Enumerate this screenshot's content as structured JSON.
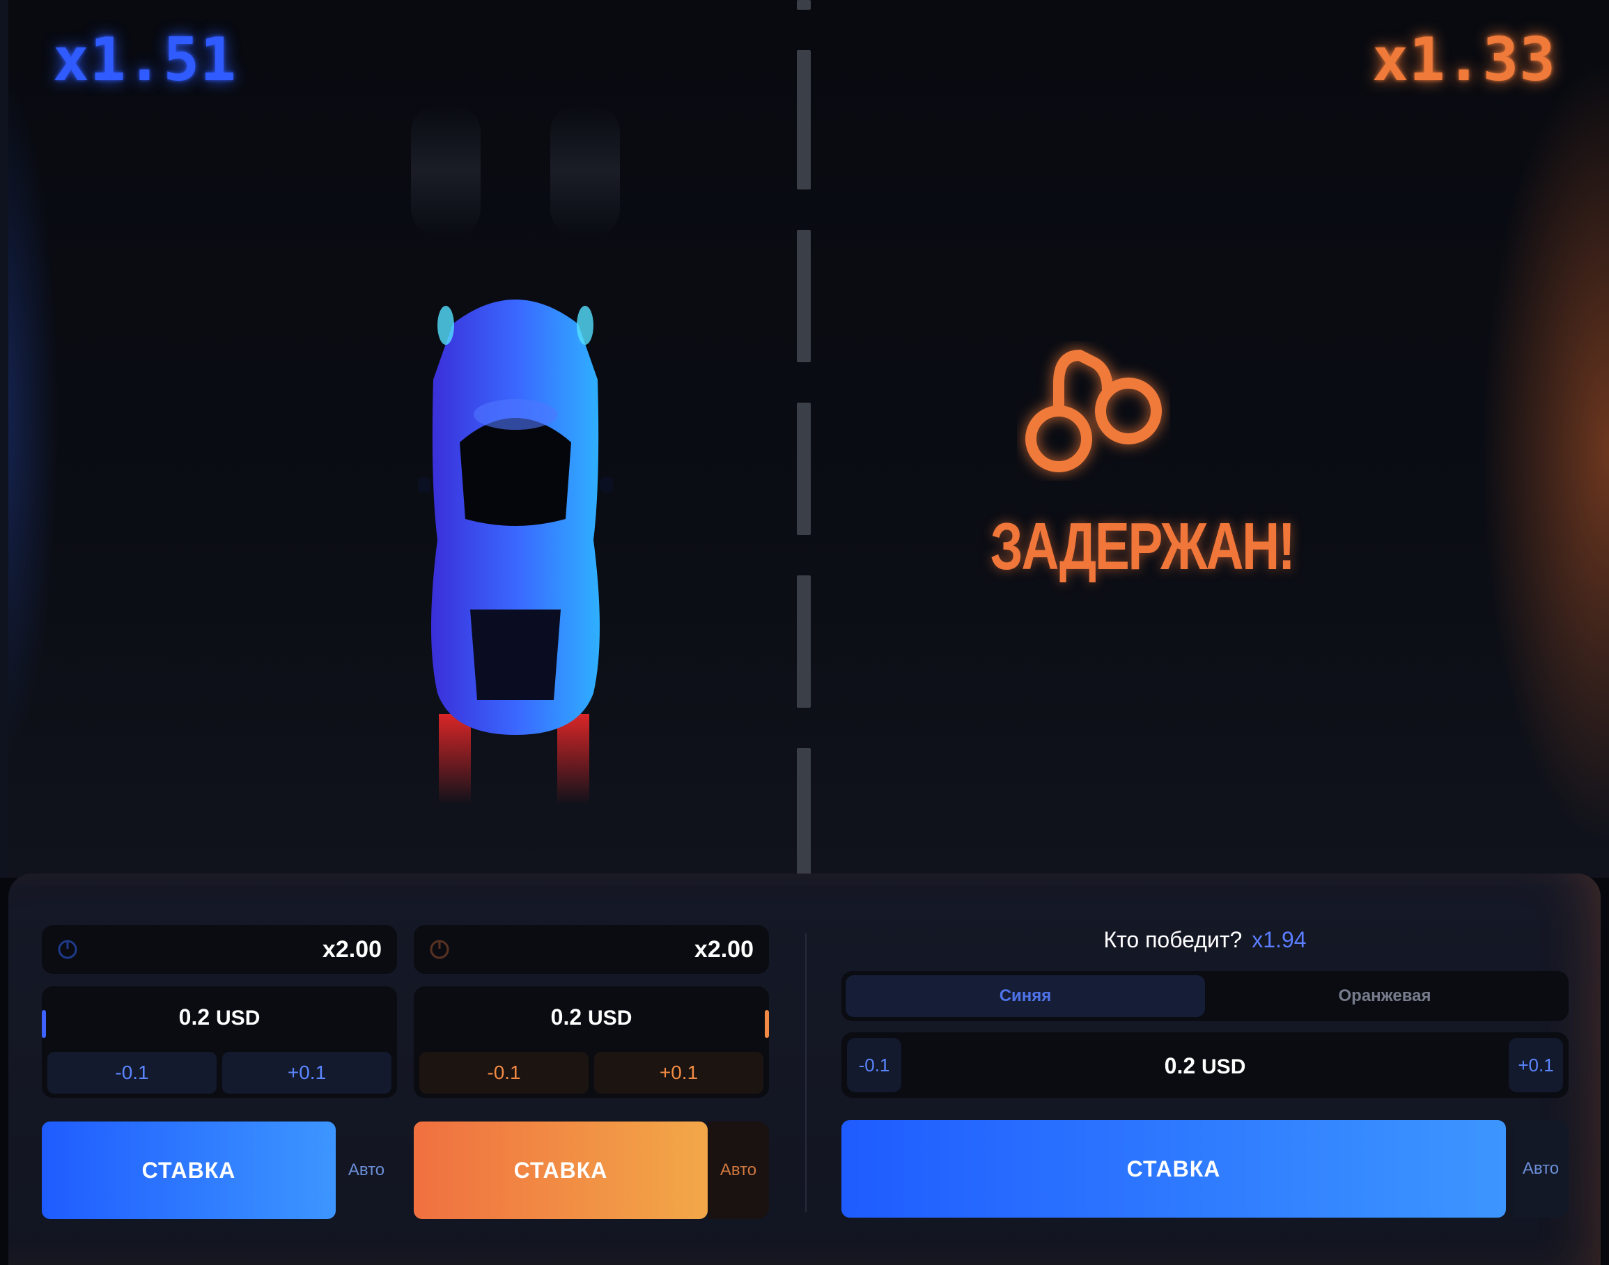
{
  "race": {
    "blue_multiplier": "x1.51",
    "orange_multiplier": "x1.33",
    "status_text": "ЗАДЕРЖАН!",
    "colors": {
      "blue": "#2f5bff",
      "orange": "#f07a3a"
    }
  },
  "bet_panels": [
    {
      "theme": "blue",
      "cashout_value": "x2.00",
      "amount_value": "0.2",
      "amount_unit": "USD",
      "minus_label": "-0.1",
      "plus_label": "+0.1",
      "bet_label": "СТАВКА",
      "auto_label": "Авто"
    },
    {
      "theme": "orange",
      "cashout_value": "x2.00",
      "amount_value": "0.2",
      "amount_unit": "USD",
      "minus_label": "-0.1",
      "plus_label": "+0.1",
      "bet_label": "СТАВКА",
      "auto_label": "Авто"
    }
  ],
  "winner_bet": {
    "question": "Кто победит?",
    "multiplier": "x1.94",
    "options": [
      "Синяя",
      "Оранжевая"
    ],
    "selected": "Синяя",
    "minus_label": "-0.1",
    "plus_label": "+0.1",
    "amount_value": "0.2",
    "amount_unit": "USD",
    "bet_label": "СТАВКА",
    "auto_label": "Авто"
  },
  "icons": [
    "power-icon",
    "handcuffs-icon",
    "blue-car"
  ]
}
